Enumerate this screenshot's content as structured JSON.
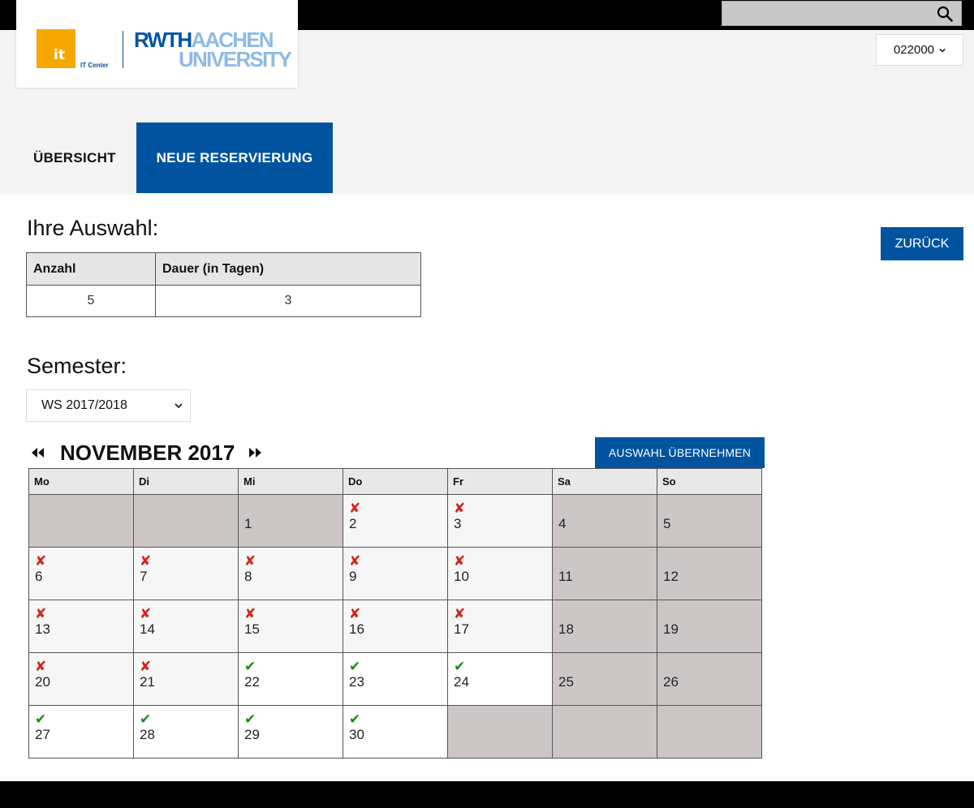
{
  "search": {
    "value": ""
  },
  "logo": {
    "it_mark": "it",
    "it_center": "IT Center",
    "rwth_strong": "RWTH",
    "rwth_light": "AACHEN",
    "rwth_line2": "UNIVERSITY"
  },
  "user": {
    "id": "022000"
  },
  "nav": {
    "tabs": [
      {
        "label": "ÜBERSICHT"
      },
      {
        "label": "NEUE RESERVIERUNG"
      }
    ]
  },
  "selection": {
    "title": "Ihre Auswahl:",
    "columns": [
      "Anzahl",
      "Dauer (in Tagen)"
    ],
    "values": [
      "5",
      "3"
    ]
  },
  "back_label": "ZURÜCK",
  "semester": {
    "title": "Semester:",
    "selected": "WS 2017/2018"
  },
  "calendar": {
    "month_title": "NOVEMBER 2017",
    "apply_label": "AUSWAHL ÜBERNEHMEN",
    "weekdays": [
      "Mo",
      "Di",
      "Mi",
      "Do",
      "Fr",
      "Sa",
      "So"
    ],
    "weeks": [
      [
        {
          "day": "",
          "mark": "",
          "bg": "gray"
        },
        {
          "day": "",
          "mark": "",
          "bg": "gray"
        },
        {
          "day": "1",
          "mark": "",
          "bg": "gray"
        },
        {
          "day": "2",
          "mark": "✘",
          "bg": "light"
        },
        {
          "day": "3",
          "mark": "✘",
          "bg": "light"
        },
        {
          "day": "4",
          "mark": "",
          "bg": "gray"
        },
        {
          "day": "5",
          "mark": "",
          "bg": "gray"
        }
      ],
      [
        {
          "day": "6",
          "mark": "✘",
          "bg": "light"
        },
        {
          "day": "7",
          "mark": "✘",
          "bg": "light"
        },
        {
          "day": "8",
          "mark": "✘",
          "bg": "light"
        },
        {
          "day": "9",
          "mark": "✘",
          "bg": "light"
        },
        {
          "day": "10",
          "mark": "✘",
          "bg": "light"
        },
        {
          "day": "11",
          "mark": "",
          "bg": "gray"
        },
        {
          "day": "12",
          "mark": "",
          "bg": "gray"
        }
      ],
      [
        {
          "day": "13",
          "mark": "✘",
          "bg": "light"
        },
        {
          "day": "14",
          "mark": "✘",
          "bg": "light"
        },
        {
          "day": "15",
          "mark": "✘",
          "bg": "light"
        },
        {
          "day": "16",
          "mark": "✘",
          "bg": "light"
        },
        {
          "day": "17",
          "mark": "✘",
          "bg": "light"
        },
        {
          "day": "18",
          "mark": "",
          "bg": "gray"
        },
        {
          "day": "19",
          "mark": "",
          "bg": "gray"
        }
      ],
      [
        {
          "day": "20",
          "mark": "✘",
          "bg": "light"
        },
        {
          "day": "21",
          "mark": "✘",
          "bg": "light"
        },
        {
          "day": "22",
          "mark": "✔",
          "bg": "white"
        },
        {
          "day": "23",
          "mark": "✔",
          "bg": "white"
        },
        {
          "day": "24",
          "mark": "✔",
          "bg": "white"
        },
        {
          "day": "25",
          "mark": "",
          "bg": "gray"
        },
        {
          "day": "26",
          "mark": "",
          "bg": "gray"
        }
      ],
      [
        {
          "day": "27",
          "mark": "✔",
          "bg": "white"
        },
        {
          "day": "28",
          "mark": "✔",
          "bg": "white"
        },
        {
          "day": "29",
          "mark": "✔",
          "bg": "white"
        },
        {
          "day": "30",
          "mark": "✔",
          "bg": "white"
        },
        {
          "day": "",
          "mark": "",
          "bg": "gray"
        },
        {
          "day": "",
          "mark": "",
          "bg": "gray"
        },
        {
          "day": "",
          "mark": "",
          "bg": "gray"
        }
      ]
    ]
  },
  "colors": {
    "brand_blue": "#00549f",
    "brand_light_blue": "#8ebae5",
    "it_orange": "#f6a800",
    "unavailable_red": "#d0261f",
    "available_green": "#1a8a1a",
    "weekend_gray": "#cdc6c6"
  },
  "icons": {
    "search": "search-icon",
    "user_dropdown": "chevron-down-icon",
    "semester_dropdown": "chevron-down-icon",
    "prev_month": "double-chevron-left-icon",
    "next_month": "double-chevron-right-icon",
    "unavailable": "cross-icon",
    "available": "check-icon"
  }
}
